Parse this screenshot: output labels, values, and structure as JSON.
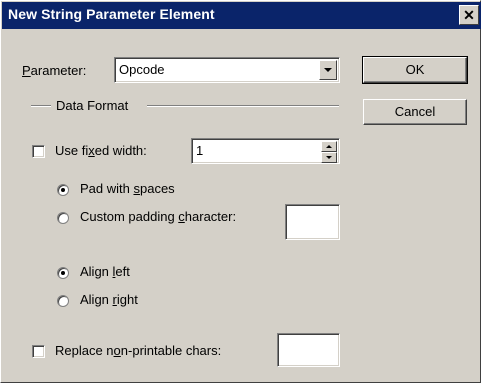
{
  "dialog": {
    "title": "New String Parameter Element",
    "close_glyph": "✕"
  },
  "parameter": {
    "label_prefix": "",
    "label_accel": "P",
    "label_rest": "arameter:",
    "value": "Opcode"
  },
  "buttons": {
    "ok": "OK",
    "cancel": "Cancel"
  },
  "data_format": {
    "group_label": "Data Format"
  },
  "fixed_width": {
    "label_prefix": "Use fi",
    "label_accel": "x",
    "label_rest": "ed width:",
    "checked": false,
    "value": "1"
  },
  "padding": {
    "spaces": {
      "prefix": "Pad with ",
      "accel": "s",
      "rest": "paces",
      "selected": true
    },
    "custom": {
      "prefix": "Custom padding ",
      "accel": "c",
      "rest": "haracter:",
      "selected": false,
      "value": ""
    }
  },
  "align": {
    "left": {
      "prefix": "Align ",
      "accel": "l",
      "rest": "eft",
      "selected": true
    },
    "right": {
      "prefix": "Align ",
      "accel": "r",
      "rest": "ight",
      "selected": false
    }
  },
  "replace": {
    "prefix": "Replace n",
    "accel": "o",
    "rest": "n-printable chars:",
    "checked": false,
    "value": ""
  },
  "colors": {
    "titlebar": "#0a246a",
    "face": "#d4d0c8"
  }
}
